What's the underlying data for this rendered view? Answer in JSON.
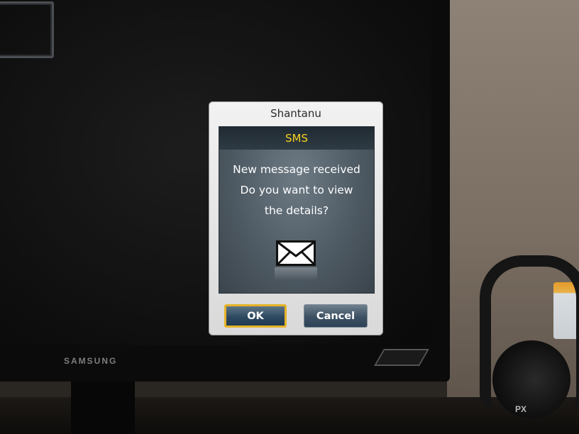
{
  "tv": {
    "brand": "SAMSUNG"
  },
  "dialog": {
    "title": "Shantanu",
    "header": "SMS",
    "message_lines": [
      "New message received",
      "Do you want to view",
      "the details?"
    ],
    "icon": "envelope-icon",
    "buttons": {
      "ok_label": "OK",
      "cancel_label": "Cancel"
    }
  },
  "headset": {
    "logo": "PX"
  },
  "colors": {
    "header_text": "#f7d21e",
    "focus_border": "#e6b42a"
  }
}
